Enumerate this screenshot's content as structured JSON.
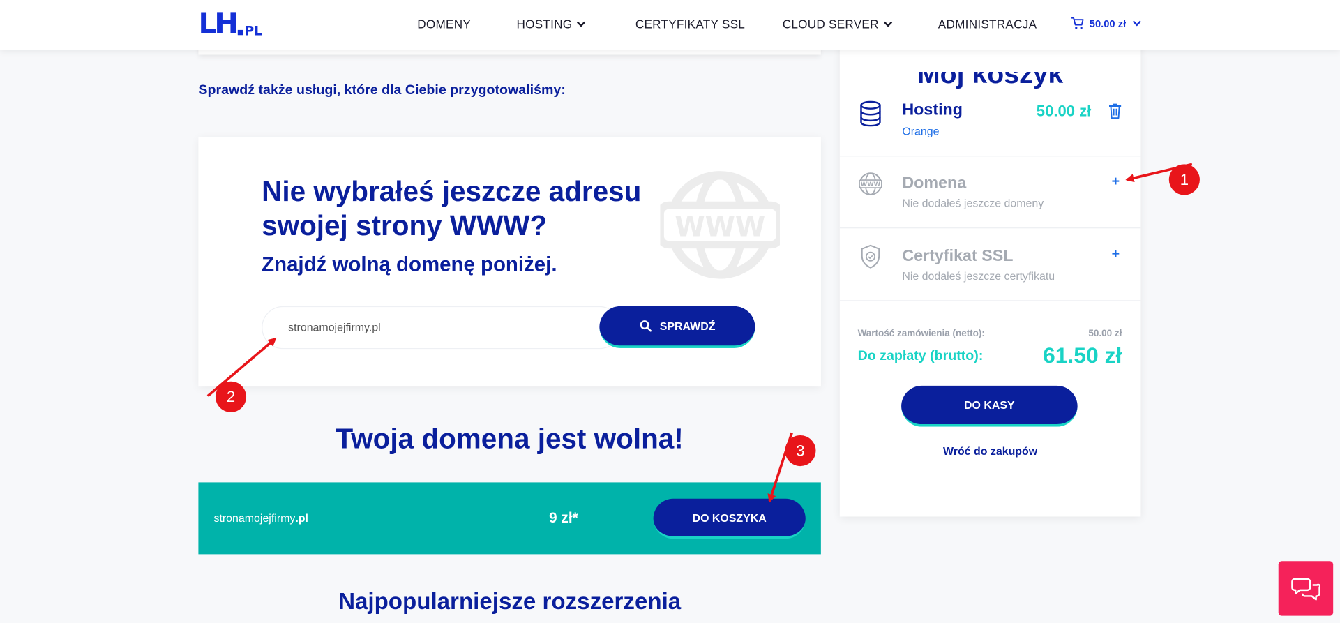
{
  "header": {
    "logo_main": "LH",
    "logo_suffix": "PL",
    "nav": [
      {
        "label": "DOMENY",
        "dropdown": false
      },
      {
        "label": "HOSTING",
        "dropdown": true
      },
      {
        "label": "CERTYFIKATY SSL",
        "dropdown": false
      },
      {
        "label": "CLOUD SERVER",
        "dropdown": true
      },
      {
        "label": "ADMINISTRACJA",
        "dropdown": false
      }
    ],
    "cart_total": "50.00 zł"
  },
  "main": {
    "also_heading": "Sprawdź także usługi, które dla Ciebie przygotowaliśmy:",
    "domain_card": {
      "title": "Nie wybrałeś jeszcze adresu swojej strony WWW?",
      "subtitle": "Znajdź wolną domenę poniżej.",
      "watermark": "WWW",
      "search_value": "stronamojejfirmy.pl",
      "search_button": "SPRAWDŹ"
    },
    "free_title": "Twoja domena jest wolna!",
    "result": {
      "domain_name": "stronamojejfirmy",
      "domain_ext": ".pl",
      "price": "9 zł*",
      "button": "DO KOSZYKA"
    },
    "popular_title": "Najpopularniejsze rozszerzenia"
  },
  "cart": {
    "title": "Mój koszyk",
    "items": [
      {
        "name": "Hosting",
        "sub": "Orange",
        "price": "50.00 zł",
        "icon": "database-icon",
        "active": true
      },
      {
        "name": "Domena",
        "sub": "Nie dodałeś jeszcze domeny",
        "icon": "www-icon",
        "active": false
      },
      {
        "name": "Certyfikat SSL",
        "sub": "Nie dodałeś jeszcze certyfikatu",
        "icon": "shield-icon",
        "active": false
      }
    ],
    "add_symbol": "+",
    "net_label": "Wartość zamówienia (netto):",
    "net_value": "50.00 zł",
    "gross_label": "Do zapłaty (brutto):",
    "gross_value": "61.50 zł",
    "checkout_button": "DO KASY",
    "back_link": "Wróć do zakupów"
  },
  "annotations": [
    "1",
    "2",
    "3"
  ],
  "colors": {
    "navy": "#0a1f9c",
    "teal": "#00b3aa",
    "cyan": "#19d3c5",
    "red": "#e8151a",
    "chat": "#f5225a"
  }
}
